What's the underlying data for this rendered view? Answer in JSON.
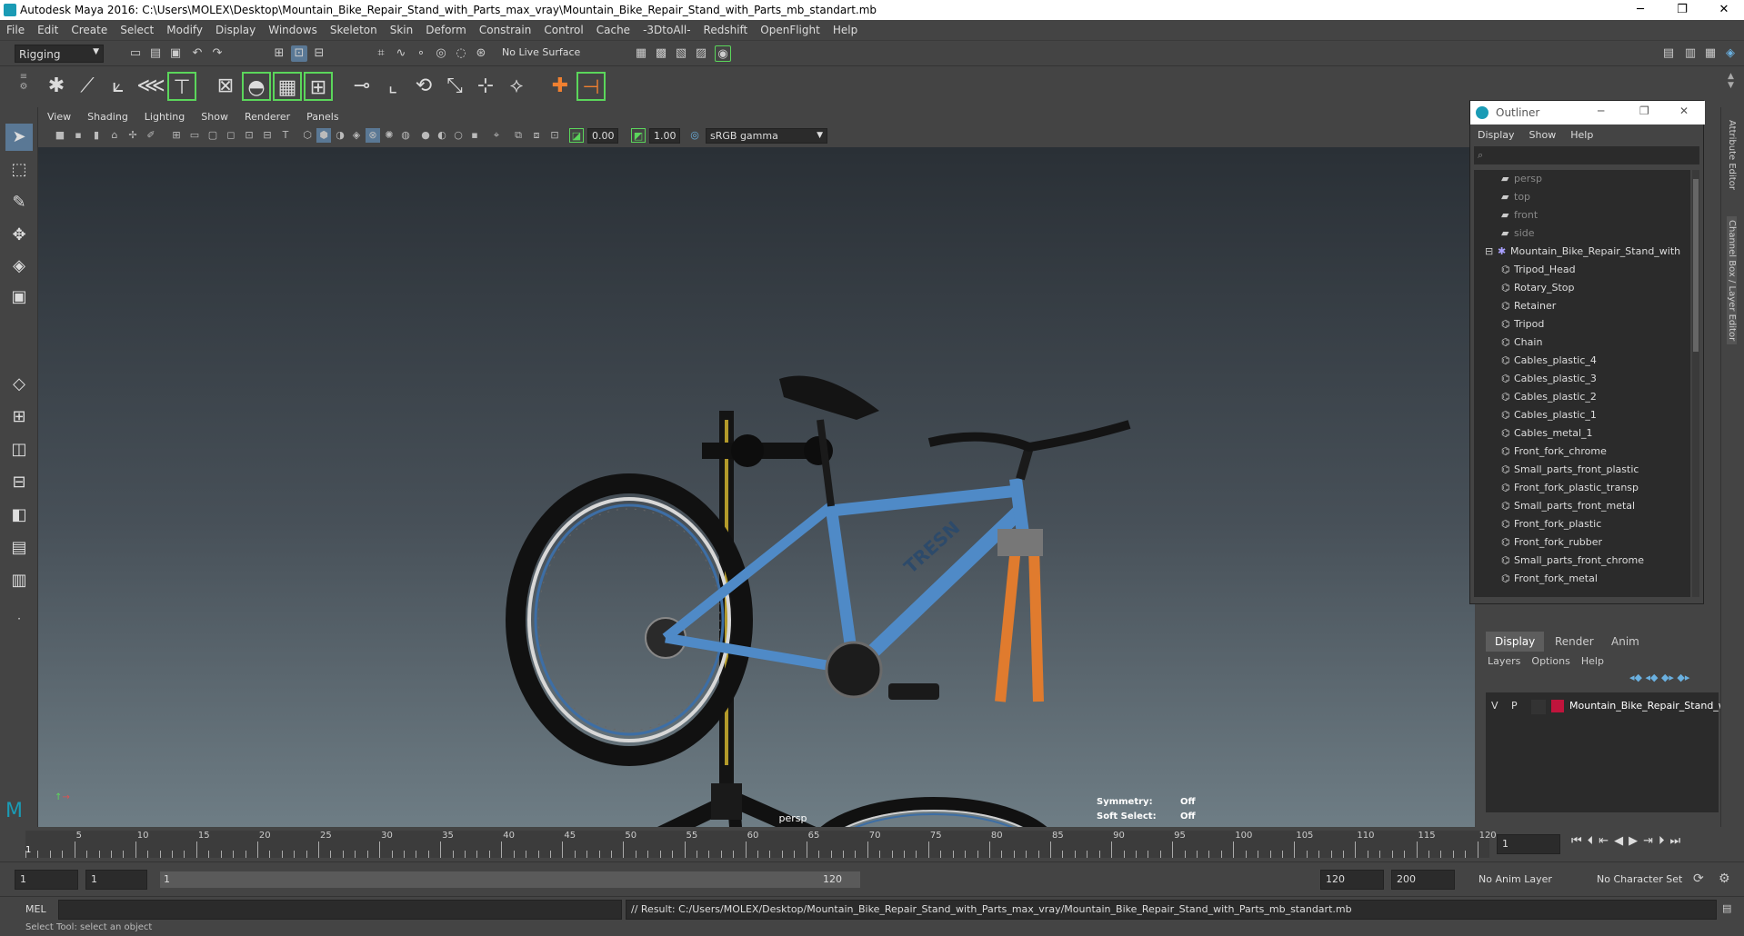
{
  "window": {
    "title": "Autodesk Maya 2016: C:\\Users\\MOLEX\\Desktop\\Mountain_Bike_Repair_Stand_with_Parts_max_vray\\Mountain_Bike_Repair_Stand_with_Parts_mb_standart.mb",
    "minimize": "─",
    "maximize": "❐",
    "close": "✕"
  },
  "menu": [
    "File",
    "Edit",
    "Create",
    "Select",
    "Modify",
    "Display",
    "Windows",
    "Skeleton",
    "Skin",
    "Deform",
    "Constrain",
    "Control",
    "Cache",
    "-3DtoAll-",
    "Redshift",
    "OpenFlight",
    "Help"
  ],
  "status": {
    "mode": "Rigging",
    "live_surface": "No Live Surface"
  },
  "panel": {
    "menu": [
      "View",
      "Shading",
      "Lighting",
      "Show",
      "Renderer",
      "Panels"
    ],
    "exposure": "0.00",
    "gamma": "1.00",
    "colorspace": "sRGB gamma"
  },
  "viewport": {
    "camera": "persp",
    "symmetry_label": "Symmetry:",
    "symmetry_value": "Off",
    "softselect_label": "Soft Select:",
    "softselect_value": "Off",
    "frame_brand": "TRESN"
  },
  "outliner": {
    "title": "Outliner",
    "menu": [
      "Display",
      "Show",
      "Help"
    ],
    "cameras": [
      "persp",
      "top",
      "front",
      "side"
    ],
    "root": "Mountain_Bike_Repair_Stand_with",
    "children": [
      "Tripod_Head",
      "Rotary_Stop",
      "Retainer",
      "Tripod",
      "Chain",
      "Cables_plastic_4",
      "Cables_plastic_3",
      "Cables_plastic_2",
      "Cables_plastic_1",
      "Cables_metal_1",
      "Front_fork_chrome",
      "Small_parts_front_plastic",
      "Front_fork_plastic_transp",
      "Small_parts_front_metal",
      "Front_fork_plastic",
      "Front_fork_rubber",
      "Small_parts_front_chrome",
      "Front_fork_metal"
    ]
  },
  "layers": {
    "tabs": [
      "Display",
      "Render",
      "Anim"
    ],
    "menu": [
      "Layers",
      "Options",
      "Help"
    ],
    "row": {
      "v": "V",
      "p": "P",
      "name": "Mountain_Bike_Repair_Stand_wi",
      "color": "#c0143c"
    }
  },
  "sidebar": {
    "attribute_editor": "Attribute Editor",
    "channel_box": "Channel Box / Layer Editor"
  },
  "timeline": {
    "ticks": [
      "5",
      "10",
      "15",
      "20",
      "25",
      "30",
      "35",
      "40",
      "45",
      "50",
      "55",
      "60",
      "65",
      "70",
      "75",
      "80",
      "85",
      "90",
      "95",
      "100",
      "105",
      "110",
      "115",
      "120"
    ],
    "start_label": "1",
    "current_frame": "1"
  },
  "range": {
    "start": "1",
    "playback_start": "1",
    "slider_start": "1",
    "slider_end": "120",
    "playback_end": "120",
    "end": "200",
    "anim_layer": "No Anim Layer",
    "character_set": "No Character Set"
  },
  "command": {
    "lang": "MEL",
    "result": "// Result: C:/Users/MOLEX/Desktop/Mountain_Bike_Repair_Stand_with_Parts_max_vray/Mountain_Bike_Repair_Stand_with_Parts_mb_standart.mb"
  },
  "help_line": "Select Tool: select an object"
}
